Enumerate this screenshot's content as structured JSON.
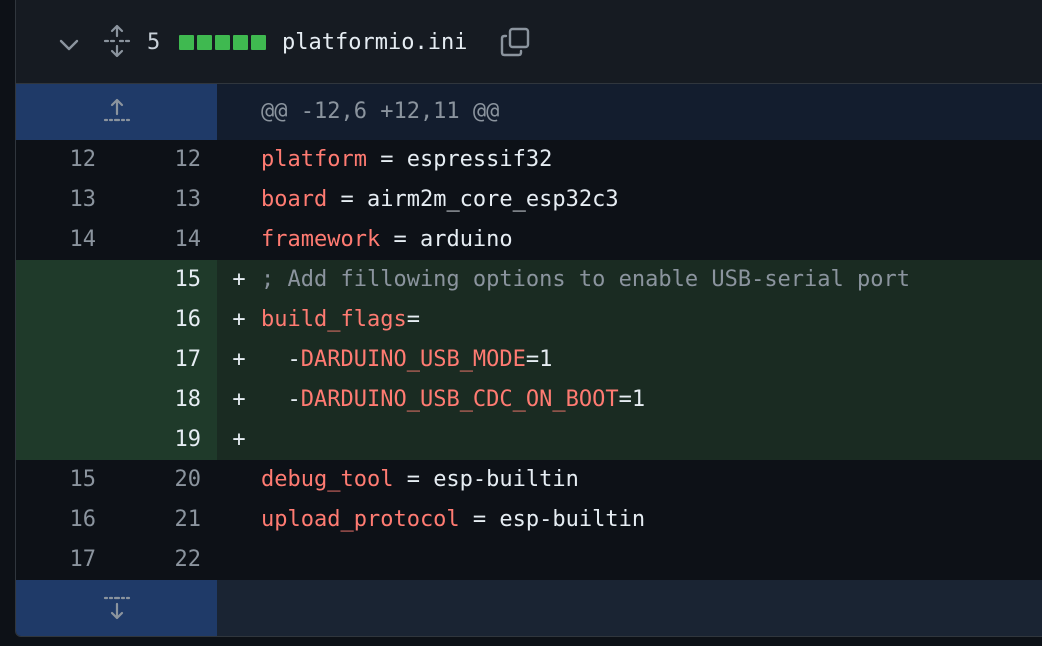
{
  "file_header": {
    "changes_count": "5",
    "diff_bars": [
      "added",
      "added",
      "added",
      "added",
      "added"
    ],
    "filename": "platformio.ini",
    "icons": {
      "collapse": "chevron-down-icon",
      "expand": "unfold-icon",
      "copy": "copy-icon"
    }
  },
  "hunk_top": {
    "header": "@@ -12,6 +12,11 @@",
    "icon": "expand-up-icon"
  },
  "lines": [
    {
      "old": "12",
      "new": "12",
      "type": "context",
      "key": "platform",
      "rest": " = espressif32"
    },
    {
      "old": "13",
      "new": "13",
      "type": "context",
      "key": "board",
      "rest": " = airm2m_core_esp32c3"
    },
    {
      "old": "14",
      "new": "14",
      "type": "context",
      "key": "framework",
      "rest": " = arduino"
    },
    {
      "old": "",
      "new": "15",
      "type": "added",
      "comment": "; Add fillowing options to enable USB-serial port"
    },
    {
      "old": "",
      "new": "16",
      "type": "added",
      "key": "build_flags",
      "rest": "="
    },
    {
      "old": "",
      "new": "17",
      "type": "added",
      "pre": "  -",
      "key": "DARDUINO_USB_MODE",
      "rest": "=1"
    },
    {
      "old": "",
      "new": "18",
      "type": "added",
      "pre": "  -",
      "key": "DARDUINO_USB_CDC_ON_BOOT",
      "rest": "=1"
    },
    {
      "old": "",
      "new": "19",
      "type": "added",
      "rest": ""
    },
    {
      "old": "15",
      "new": "20",
      "type": "context",
      "key": "debug_tool",
      "rest": " = esp-builtin"
    },
    {
      "old": "16",
      "new": "21",
      "type": "context",
      "key": "upload_protocol",
      "rest": " = esp-builtin"
    },
    {
      "old": "17",
      "new": "22",
      "type": "context",
      "rest": ""
    }
  ],
  "markers": {
    "added": "+",
    "context": ""
  },
  "hunk_bottom": {
    "icon": "expand-down-icon"
  },
  "colors": {
    "added_bar": "#3fb950",
    "hunk_gutter": "#1f3a68",
    "keyword": "#ff7b72",
    "comment": "#8b949e"
  }
}
